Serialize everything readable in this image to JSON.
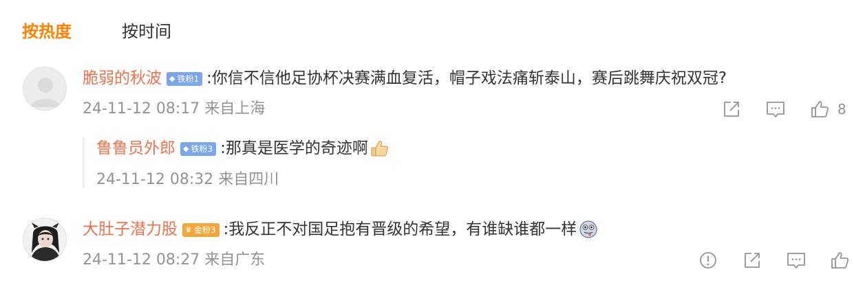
{
  "tabs": {
    "hot": "按热度",
    "time": "按时间"
  },
  "comments": [
    {
      "user": "脆弱的秋波",
      "badge": "铁粉1",
      "text": ":你信不信他足协杯决赛满血复活，帽子戏法痛斩泰山，赛后跳舞庆祝双冠?",
      "time": "24-11-12 08:17",
      "location": "来自上海",
      "likes": "8",
      "reply": {
        "user": "鲁鲁员外郎",
        "badge": "铁粉3",
        "text": ":那真是医学的奇迹啊",
        "emoji": "thumbs-up",
        "time": "24-11-12 08:32",
        "location": "来自四川"
      }
    },
    {
      "user": "大肚子潜力股",
      "badge": "金粉3",
      "text": ":我反正不对国足抱有晋级的希望，有谁缺谁都一样",
      "emoji": "tongue-out-face",
      "time": "24-11-12 08:27",
      "location": "来自广东"
    }
  ],
  "icons": [
    "share-icon",
    "comment-icon",
    "like-icon",
    "report-icon"
  ],
  "colors": {
    "accent": "#ff8200",
    "username": "#eb7350",
    "meta": "#939393",
    "iron_badge": "#7aa6ea",
    "gold_badge": "#f3a73a"
  }
}
